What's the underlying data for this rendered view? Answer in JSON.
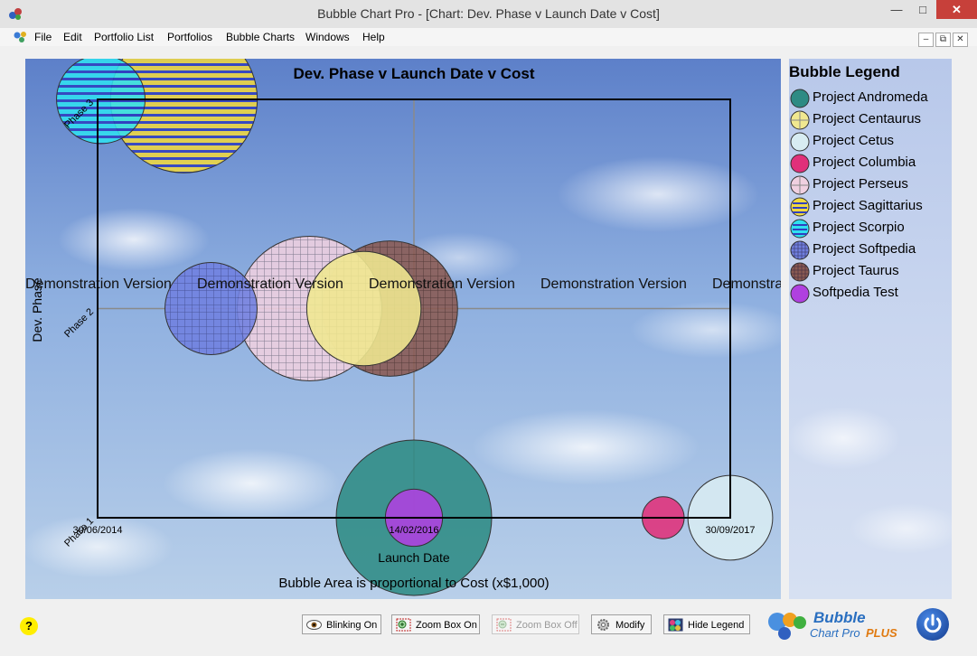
{
  "window": {
    "title": "Bubble Chart Pro - [Chart: Dev. Phase v Launch Date v Cost]"
  },
  "menu": [
    "File",
    "Edit",
    "Portfolio List",
    "Portfolios",
    "Bubble Charts",
    "Windows",
    "Help"
  ],
  "chart_data": {
    "type": "scatter",
    "title": "Dev. Phase v Launch Date v Cost",
    "xlabel": "Launch Date",
    "ylabel": "Dev. Phase",
    "subtitle": "Bubble Area is proportional to Cost (x$1,000)",
    "x_ticks": [
      "30/06/2014",
      "14/02/2016",
      "30/09/2017"
    ],
    "y_ticks": [
      "Phase 1",
      "Phase 2",
      "Phase 3"
    ],
    "watermark": "Demonstration Version",
    "series": [
      {
        "name": "Project Andromeda",
        "x": "14/02/2016",
        "y": "Phase 1",
        "color": "#2e8b84",
        "size": 7400
      },
      {
        "name": "Softpedia Test",
        "x": "14/02/2016",
        "y": "Phase 1",
        "color": "#b040e0",
        "size": 1000
      },
      {
        "name": "Project Columbia",
        "x": "27/05/2017",
        "y": "Phase 1",
        "color": "#e0307a",
        "size": 540
      },
      {
        "name": "Project Cetus",
        "x": "30/09/2017",
        "y": "Phase 1",
        "color": "#d8ecf2",
        "size": 2200
      },
      {
        "name": "Project Softpedia",
        "x": "29/01/2015",
        "y": "Phase 2",
        "color": "#7080e0",
        "size": 2600
      },
      {
        "name": "Project Taurus",
        "x": "31/12/2015",
        "y": "Phase 2",
        "color": "#8a5a52",
        "size": 5600
      },
      {
        "name": "Project Perseus",
        "x": "02/08/2015",
        "y": "Phase 2",
        "color": "#f0d0e0",
        "size": 6400
      },
      {
        "name": "Project Centaurus",
        "x": "12/11/2015",
        "y": "Phase 2",
        "color": "#f0e890",
        "size": 4000
      },
      {
        "name": "Project Scorpio",
        "x": "06/07/2014",
        "y": "Phase 3",
        "color": "#30e0f0",
        "size": 2400
      },
      {
        "name": "Project Sagittarius",
        "x": "09/12/2014",
        "y": "Phase 3",
        "color": "#f0d840",
        "size": 6600
      }
    ]
  },
  "legend": {
    "title": "Bubble Legend",
    "items": [
      {
        "label": "Project Andromeda",
        "color": "#2e8b84",
        "pattern": "solid"
      },
      {
        "label": "Project Centaurus",
        "color": "#f0e890",
        "pattern": "cross"
      },
      {
        "label": "Project Cetus",
        "color": "#d8ecf2",
        "pattern": "solid"
      },
      {
        "label": "Project Columbia",
        "color": "#e0307a",
        "pattern": "solid"
      },
      {
        "label": "Project Perseus",
        "color": "#f0d0e0",
        "pattern": "cross"
      },
      {
        "label": "Project Sagittarius",
        "color": "#f0d840",
        "pattern": "hstripes"
      },
      {
        "label": "Project Scorpio",
        "color": "#30e0f0",
        "pattern": "hstripes"
      },
      {
        "label": "Project Softpedia",
        "color": "#7080e0",
        "pattern": "grid"
      },
      {
        "label": "Project Taurus",
        "color": "#8a5a52",
        "pattern": "grid"
      },
      {
        "label": "Softpedia Test",
        "color": "#b040e0",
        "pattern": "solid"
      }
    ]
  },
  "toolbar": {
    "help": "?",
    "blinking_on": "Blinking On",
    "zoom_box_on": "Zoom Box On",
    "zoom_box_off": "Zoom Box Off",
    "modify": "Modify",
    "hide_legend": "Hide Legend"
  },
  "logo": {
    "line1": "Bubble",
    "line2": "Chart Pro",
    "line3": "PLUS"
  }
}
